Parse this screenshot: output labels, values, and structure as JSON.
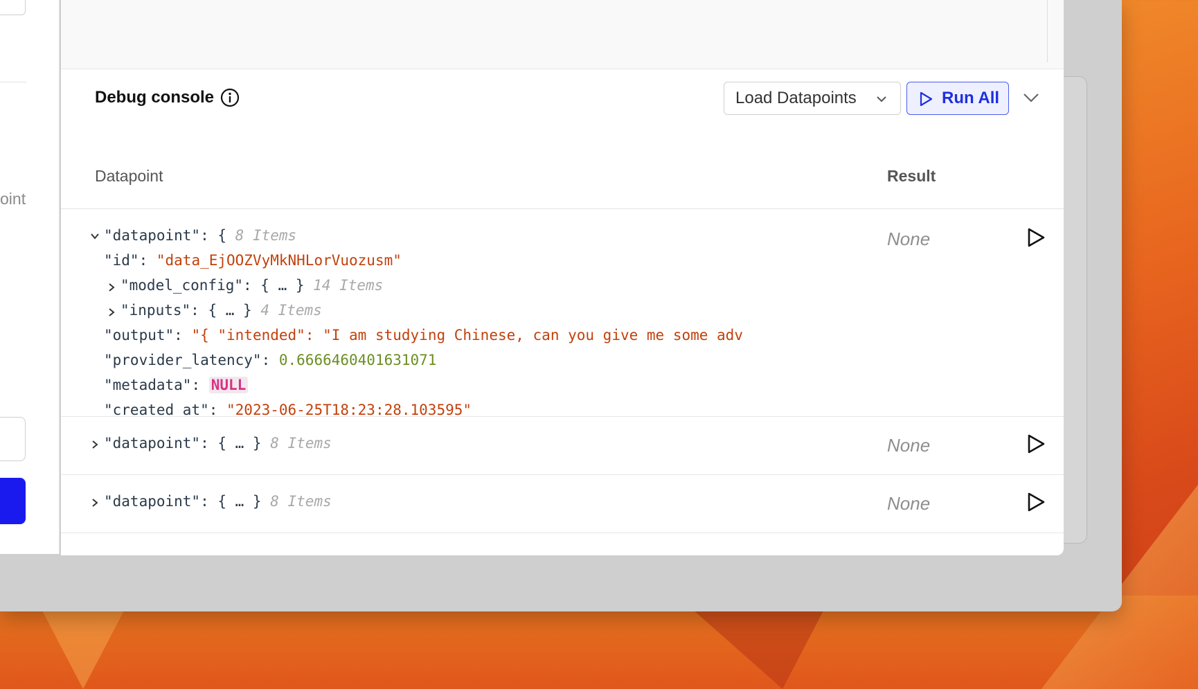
{
  "console": {
    "title": "Debug console",
    "load_button_label": "Load Datapoints",
    "run_all_label": "Run All"
  },
  "left_panel": {
    "partial_label": "oint"
  },
  "table": {
    "col_datapoint": "Datapoint",
    "col_result": "Result"
  },
  "expanded_row": {
    "root_key": "\"datapoint\"",
    "root_count": "8 Items",
    "id_key": "\"id\"",
    "id_value": "\"data_EjOOZVyMkNHLorVuozusm\"",
    "model_config_key": "\"model_config\"",
    "model_config_count": "14 Items",
    "inputs_key": "\"inputs\"",
    "inputs_count": "4 Items",
    "output_key": "\"output\"",
    "output_value": "\"{ \"intended\": \"I am studying Chinese, can you give me some adv",
    "latency_key": "\"provider_latency\"",
    "latency_value": "0.6666460401631071",
    "metadata_key": "\"metadata\"",
    "metadata_value": "NULL",
    "created_key": "\"created_at\"",
    "created_value": "\"2023-06-25T18:23:28.103595\"",
    "result": "None"
  },
  "collapsed_rows": [
    {
      "key": "\"datapoint\"",
      "count": "8 Items",
      "result": "None"
    },
    {
      "key": "\"datapoint\"",
      "count": "8 Items",
      "result": "None"
    }
  ],
  "colors": {
    "accent": "#1f2ee0",
    "string": "#c2410c",
    "number": "#6b8e23",
    "null": "#d63384"
  }
}
